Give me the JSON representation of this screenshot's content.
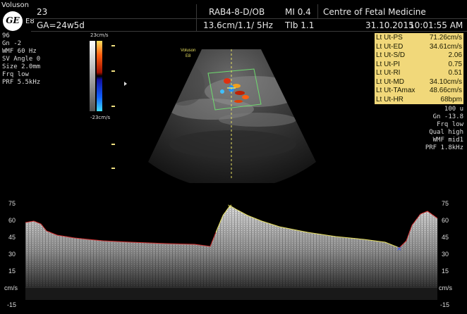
{
  "header": {
    "brand": "Voluson",
    "brand_model": "E8",
    "logo_text": "GE",
    "patient_id": "23",
    "probe_preset": "RAB4-8-D/OB",
    "mi": "MI 0.4",
    "institution": "Centre of Fetal Medicine",
    "ga": "GA=24w5d",
    "depth_freq": "13.6cm/1.1/ 5Hz",
    "tib": "TIb  1.1",
    "date": "31.10.2015",
    "time": "10:01:55 AM"
  },
  "left_params": [
    "96",
    "Gn  -2",
    "WMF 60 Hz",
    "SV Angle  0",
    "Size  2.0mm",
    "Frq low",
    "PRF  5.5kHz"
  ],
  "color_scale": {
    "top_label": "23cm/s",
    "bottom_label": "-23cm/s"
  },
  "image_overlay": {
    "brand": "Voluson",
    "model": "E8"
  },
  "measurements": [
    {
      "label": "Lt Ut-PS",
      "value": "71.26cm/s"
    },
    {
      "label": "Lt Ut-ED",
      "value": "34.61cm/s"
    },
    {
      "label": "Lt Ut-S/D",
      "value": "2.06"
    },
    {
      "label": "Lt Ut-PI",
      "value": "0.75"
    },
    {
      "label": "Lt Ut-RI",
      "value": "0.51"
    },
    {
      "label": "Lt Ut-MD",
      "value": "34.10cm/s"
    },
    {
      "label": "Lt Ut-TAmax",
      "value": "48.66cm/s"
    },
    {
      "label": "Lt Ut-HR",
      "value": "68bpm"
    }
  ],
  "right_params": [
    "100 u",
    "Gn -13.8",
    "Frq low",
    "Qual high",
    "WMF mid1",
    "PRF  1.8kHz"
  ],
  "doppler_axis": {
    "ticks": [
      "75",
      "60",
      "45",
      "30",
      "15",
      "-15"
    ],
    "unit": "cm/s"
  },
  "colors": {
    "measurement_bg": "#f1d87a",
    "trace_red": "#d03030",
    "trace_yellow": "#e8e060",
    "sample_box": "#6fdc6f"
  }
}
